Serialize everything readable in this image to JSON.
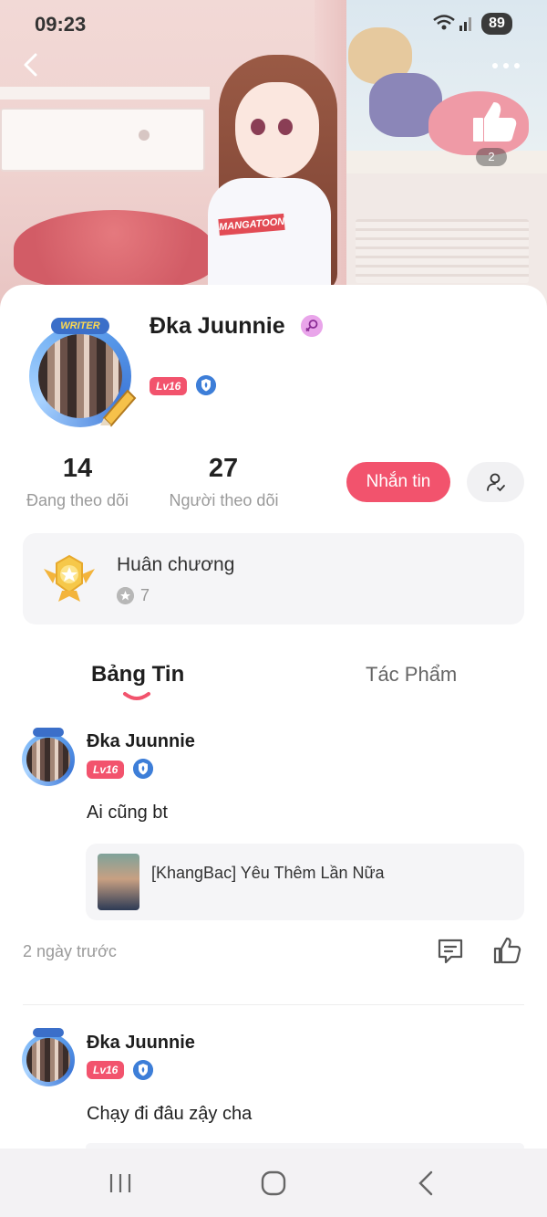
{
  "status_bar": {
    "time": "09:23",
    "battery": "89",
    "icons": [
      "wifi-icon",
      "signal-icon",
      "battery-icon"
    ]
  },
  "header": {
    "like_count": "2",
    "shirt_text": "MANGATOON",
    "icons": [
      "back-icon",
      "more-icon",
      "thumbs-up-icon"
    ]
  },
  "profile": {
    "name": "Đka Juunnie",
    "avatar_badge": "WRITER",
    "level": "Lv16",
    "gender_icon": "female-icon",
    "verified_icon": "shield-icon"
  },
  "stats": {
    "following_count": "14",
    "following_label": "Đang theo dõi",
    "followers_count": "27",
    "followers_label": "Người theo dõi"
  },
  "actions": {
    "message_label": "Nhắn tin",
    "follow_icon": "add-person-icon"
  },
  "medals": {
    "title": "Huân chương",
    "count": "7",
    "icon": "medal-icon"
  },
  "tabs": [
    {
      "label": "Bảng Tin",
      "active": true
    },
    {
      "label": "Tác Phẩm",
      "active": false
    }
  ],
  "posts": [
    {
      "author": "Đka Juunnie",
      "level": "Lv16",
      "text": "Ai cũng bt",
      "link_title": "[KhangBac] Yêu Thêm Lần Nữa",
      "time": "2 ngày trước"
    },
    {
      "author": "Đka Juunnie",
      "level": "Lv16",
      "text": "Chạy đi đâu zậy cha"
    }
  ],
  "colors": {
    "accent": "#f2536d",
    "level_badge": "#f2536d",
    "verified": "#3d7ed8"
  },
  "navbar": {
    "icons": [
      "recent-apps-icon",
      "home-icon",
      "nav-back-icon"
    ]
  }
}
